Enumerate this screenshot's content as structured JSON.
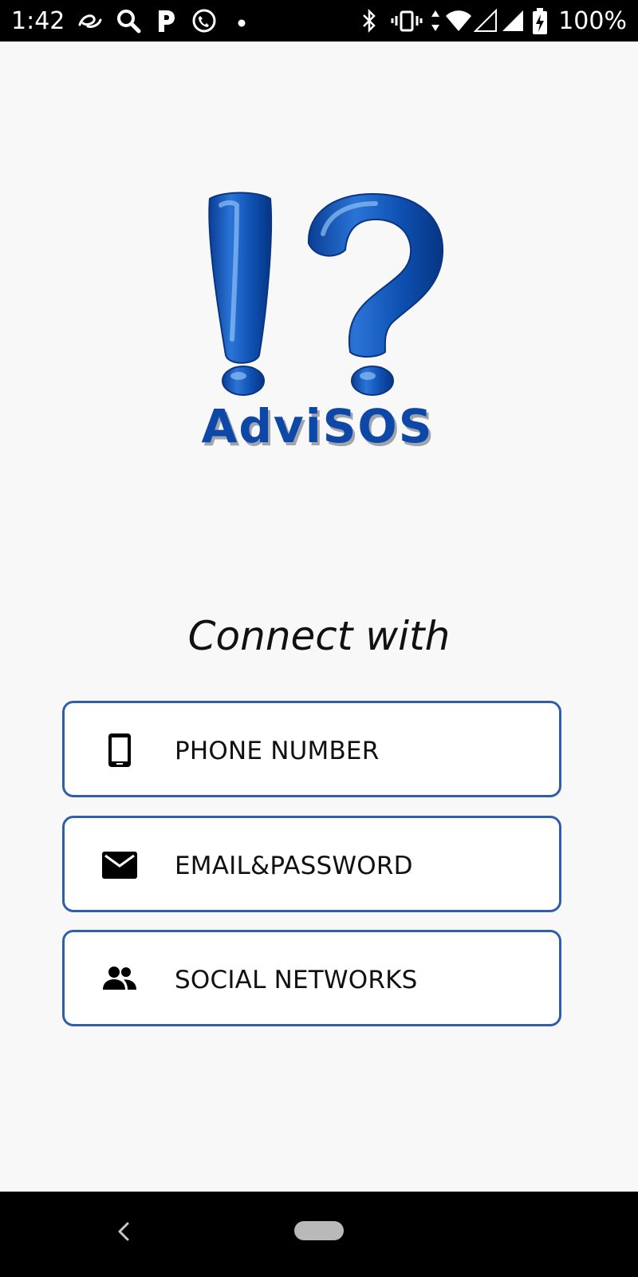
{
  "status_bar": {
    "time": "1:42",
    "battery_percent": "100%",
    "icons": [
      "alibaba-icon",
      "search-icon",
      "parking-p-icon",
      "phone-call-icon",
      "dot-icon",
      "bluetooth-icon",
      "vibrate-icon",
      "data-arrows-icon",
      "wifi-icon",
      "signal-icon",
      "signal-icon",
      "battery-charging-icon"
    ]
  },
  "logo": {
    "wordmark": "AdviSOS",
    "colors": {
      "primary": "#0d47a8",
      "shadow": "#9fa4ad"
    }
  },
  "connect": {
    "title": "Connect with"
  },
  "options": [
    {
      "label": "PHONE NUMBER",
      "icon": "smartphone-icon"
    },
    {
      "label": "EMAIL&PASSWORD",
      "icon": "mail-icon"
    },
    {
      "label": "SOCIAL NETWORKS",
      "icon": "people-icon"
    }
  ],
  "nav_bar": {
    "icons": [
      "back-icon",
      "home-pill-icon"
    ]
  },
  "theme": {
    "accent_border": "#2f5fa8",
    "background": "#f8f8f9"
  }
}
